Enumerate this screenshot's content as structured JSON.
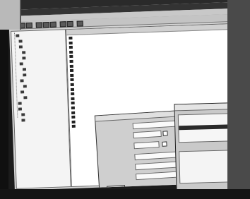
{
  "window": {
    "title": ""
  },
  "menubar": {
    "items": [
      "",
      "",
      "",
      "",
      ""
    ]
  },
  "toolbar_icons": [
    "back-icon",
    "forward-icon",
    "up-icon",
    "cut-icon",
    "copy-icon",
    "paste-icon",
    "delete-icon",
    "properties-icon",
    "view-icon"
  ],
  "tree": {
    "items": [
      "",
      "",
      "",
      "",
      "",
      "",
      "",
      "",
      "",
      "",
      "",
      "",
      "",
      "",
      "",
      ""
    ]
  },
  "list": {
    "columns": [
      "",
      "",
      "",
      "",
      ""
    ],
    "rows": [
      [
        "",
        "",
        "",
        ""
      ],
      [
        "",
        "",
        "",
        ""
      ],
      [
        "",
        "",
        "",
        ""
      ],
      [
        "",
        "",
        "",
        ""
      ],
      [
        "",
        "",
        "",
        ""
      ],
      [
        "",
        "",
        "",
        ""
      ],
      [
        "",
        "",
        "",
        ""
      ],
      [
        "",
        "",
        "",
        ""
      ],
      [
        "",
        "",
        "",
        ""
      ],
      [
        "",
        "",
        "",
        ""
      ],
      [
        "",
        "",
        "",
        ""
      ],
      [
        "",
        "",
        "",
        ""
      ],
      [
        "",
        "",
        "",
        ""
      ],
      [
        "",
        "",
        "",
        ""
      ],
      [
        "",
        "",
        "",
        ""
      ],
      [
        "",
        "",
        "",
        ""
      ],
      [
        "",
        "",
        "",
        ""
      ],
      [
        "",
        "",
        "",
        ""
      ],
      [
        "",
        "",
        "",
        ""
      ],
      [
        "",
        "",
        "",
        ""
      ]
    ]
  },
  "dialog": {
    "title": "",
    "labels": [
      "",
      "",
      "",
      "",
      "",
      ""
    ],
    "fields": [
      "",
      "",
      "",
      "",
      "",
      ""
    ],
    "button": ""
  },
  "dialog2": {
    "title": "",
    "rows": [
      [
        "",
        ""
      ],
      [
        "",
        ""
      ],
      [
        "",
        ""
      ],
      [
        "",
        ""
      ],
      [
        "",
        ""
      ]
    ],
    "status": ""
  }
}
